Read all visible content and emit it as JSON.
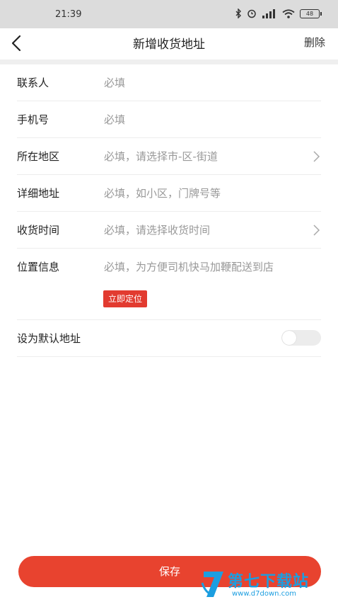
{
  "status_bar": {
    "time": "21:39",
    "battery": "48"
  },
  "header": {
    "title": "新增收货地址",
    "delete_label": "删除"
  },
  "form": {
    "rows": [
      {
        "label": "联系人",
        "placeholder": "必填"
      },
      {
        "label": "手机号",
        "placeholder": "必填"
      },
      {
        "label": "所在地区",
        "placeholder": "必填，请选择市-区-街道"
      },
      {
        "label": "详细地址",
        "placeholder": "必填，如小区，门牌号等"
      },
      {
        "label": "收货时间",
        "placeholder": "必填，请选择收货时间"
      },
      {
        "label": "位置信息",
        "placeholder": "必填，为方便司机快马加鞭配送到店"
      }
    ],
    "locate_button": "立即定位",
    "default_label": "设为默认地址",
    "default_on": false
  },
  "footer": {
    "save_label": "保存"
  },
  "watermark": {
    "brand": "第七下载站",
    "url": "www.d7down.com"
  },
  "colors": {
    "accent": "#e8432f",
    "locate": "#e23b30",
    "watermark": "#1c9ee0"
  }
}
